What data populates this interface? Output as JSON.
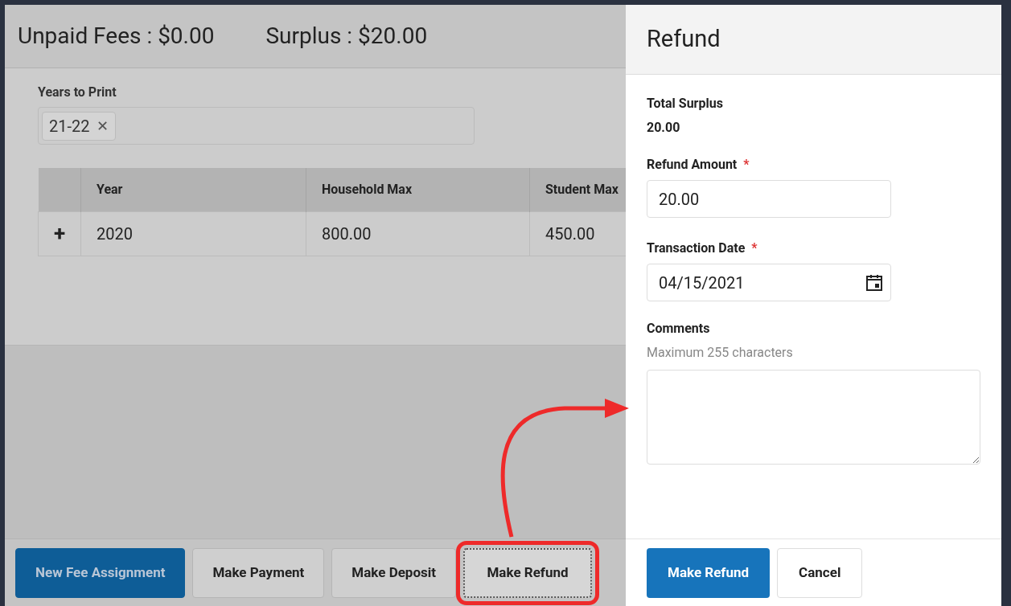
{
  "summary": [
    {
      "label": "Unpaid Fees : $0.00"
    },
    {
      "label": "Surplus : $20.00"
    }
  ],
  "years_filter": {
    "label": "Years to Print",
    "chips": [
      "21-22"
    ],
    "remove_icon": "✕"
  },
  "table": {
    "columns": [
      "Year",
      "Household Max",
      "Student Max"
    ],
    "rows": [
      {
        "expand": "+",
        "cells": [
          "2020",
          "800.00",
          "450.00"
        ]
      }
    ]
  },
  "action_bar": [
    {
      "label": "New Fee Assignment",
      "primary": true,
      "highlighted": false
    },
    {
      "label": "Make Payment",
      "primary": false,
      "highlighted": false
    },
    {
      "label": "Make Deposit",
      "primary": false,
      "highlighted": false
    },
    {
      "label": "Make Refund",
      "primary": false,
      "highlighted": true
    }
  ],
  "refund_panel": {
    "title": "Refund",
    "total_label": "Total Surplus",
    "total_value": "20.00",
    "fields": [
      {
        "label": "Refund Amount",
        "required": true,
        "value": "20.00",
        "kind": "text"
      },
      {
        "label": "Transaction Date",
        "required": true,
        "value": "04/15/2021",
        "kind": "date"
      }
    ],
    "required_mark": "*",
    "comments": {
      "label": "Comments",
      "hint": "Maximum 255 characters"
    },
    "buttons": [
      {
        "label": "Make Refund",
        "primary": true
      },
      {
        "label": "Cancel",
        "primary": false
      }
    ]
  }
}
